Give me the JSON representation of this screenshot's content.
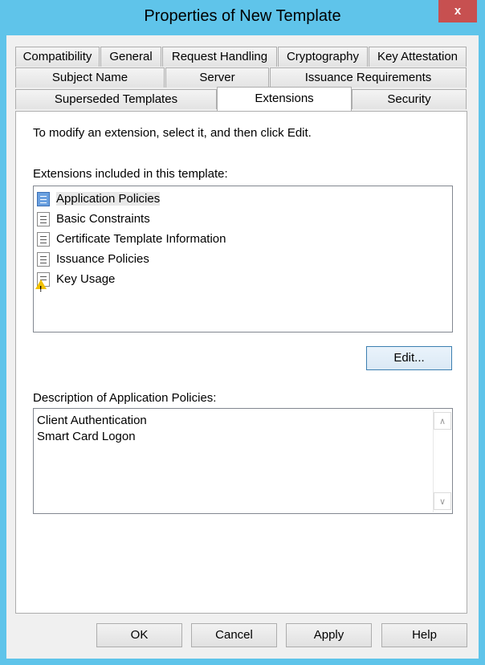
{
  "window": {
    "title": "Properties of New Template",
    "close_glyph": "x"
  },
  "tabs": {
    "row1": [
      "Compatibility",
      "General",
      "Request Handling",
      "Cryptography",
      "Key Attestation"
    ],
    "row2": [
      "Subject Name",
      "Server",
      "Issuance Requirements"
    ],
    "row3": [
      "Superseded Templates",
      "Extensions",
      "Security"
    ],
    "active": "Extensions"
  },
  "panel": {
    "instruction": "To modify an extension, select it, and then click Edit.",
    "extensions_label": "Extensions included in this template:",
    "extensions": [
      {
        "label": "Application Policies",
        "icon": "extension-icon-selected",
        "selected": true
      },
      {
        "label": "Basic Constraints",
        "icon": "extension-icon"
      },
      {
        "label": "Certificate Template Information",
        "icon": "extension-icon"
      },
      {
        "label": "Issuance Policies",
        "icon": "extension-icon"
      },
      {
        "label": "Key Usage",
        "icon": "warning-extension-icon"
      }
    ],
    "edit_button": "Edit...",
    "description_label": "Description of Application Policies:",
    "description_lines": [
      "Client Authentication",
      "Smart Card Logon"
    ]
  },
  "footer": {
    "ok": "OK",
    "cancel": "Cancel",
    "apply": "Apply",
    "help": "Help"
  },
  "colors": {
    "window_frame": "#5fc4ea",
    "close_button": "#c75050",
    "dialog_bg": "#f0f0f0"
  }
}
